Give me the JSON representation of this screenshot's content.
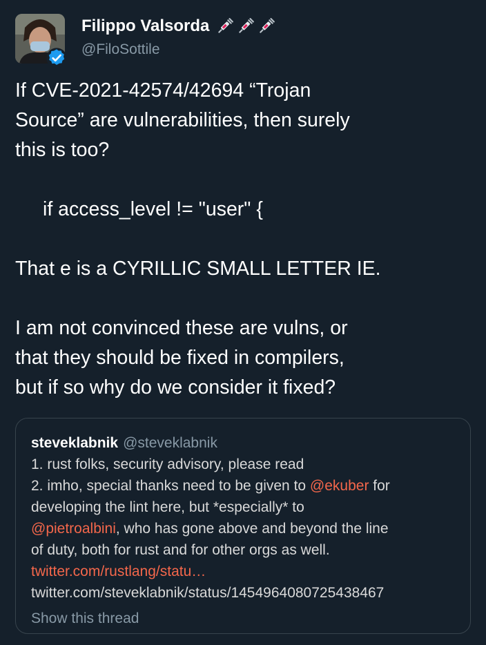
{
  "author": {
    "display_name": "Filippo Valsorda",
    "handle": "@FiloSottile",
    "name_emojis": [
      "syringe-icon",
      "syringe-icon",
      "syringe-icon"
    ],
    "verified": true
  },
  "tweet": {
    "line1": "If CVE-2021-42574/42694 “Trojan",
    "line2": "Source” are vulnerabilities, then surely",
    "line3": "this is too?",
    "code": "if access_level != \"user\" {",
    "line4": "That e is a CYRILLIC SMALL LETTER IE.",
    "line5": "I am not convinced these are vulns, or",
    "line6": "that they should be fixed in compilers,",
    "line7": "but if so why do we consider it fixed?"
  },
  "quoted_tweet": {
    "author_name": "steveklabnik",
    "author_handle": "@steveklabnik",
    "line1": "1. rust folks, security advisory, please read",
    "line2_prefix": "2. imho, special thanks need to be given to ",
    "mention1": "@ekuber",
    "line2_suffix": " for",
    "line3": "developing the lint here, but *especially* to",
    "mention2": "@pietroalbini",
    "line4_suffix": ", who has gone above and beyond the line",
    "line5": "of duty, both for rust and for other orgs as well.",
    "link": "twitter.com/rustlang/statu…",
    "url": "twitter.com/steveklabnik/status/1454964080725438467",
    "show_thread": "Show this thread"
  },
  "colors": {
    "background": "#15202b",
    "text": "#ffffff",
    "muted": "#8899a6",
    "accent": "#f4674b",
    "verified": "#1d9bf0",
    "border": "#38444d"
  }
}
